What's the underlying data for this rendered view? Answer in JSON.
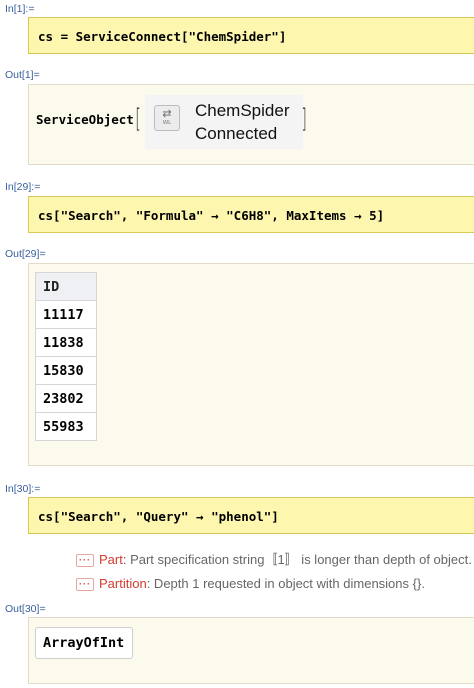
{
  "cells": {
    "in1": {
      "label": "In[1]:=",
      "code": "cs = ServiceConnect[\"ChemSpider\"]"
    },
    "out1": {
      "label": "Out[1]=",
      "head": "ServiceObject",
      "icon_caption": "WL",
      "icon": "arrows-swap-icon",
      "line1": "ChemSpider",
      "line2": "Connected"
    },
    "in29": {
      "label": "In[29]:=",
      "code": "cs[\"Search\", \"Formula\" → \"C6H8\", MaxItems → 5]"
    },
    "out29": {
      "label": "Out[29]=",
      "header": "ID",
      "rows": [
        "11117",
        "11838",
        "15830",
        "23802",
        "55983"
      ]
    },
    "in30": {
      "label": "In[30]:=",
      "code": "cs[\"Search\", \"Query\" → \"phenol\"]"
    },
    "messages": [
      {
        "dots": "···",
        "tag": "Part",
        "text": ": Part specification string〚1〛 is longer than depth of object."
      },
      {
        "dots": "···",
        "tag": "Partition",
        "text": ": Depth 1 requested in object with dimensions {}."
      }
    ],
    "out30": {
      "label": "Out[30]=",
      "value": "ArrayOfInt"
    }
  },
  "colors": {
    "input_bg": "#fdf6ae",
    "output_bg": "#fcf9ed",
    "label": "#3a5f9e",
    "message_tag": "#d23b2e"
  }
}
